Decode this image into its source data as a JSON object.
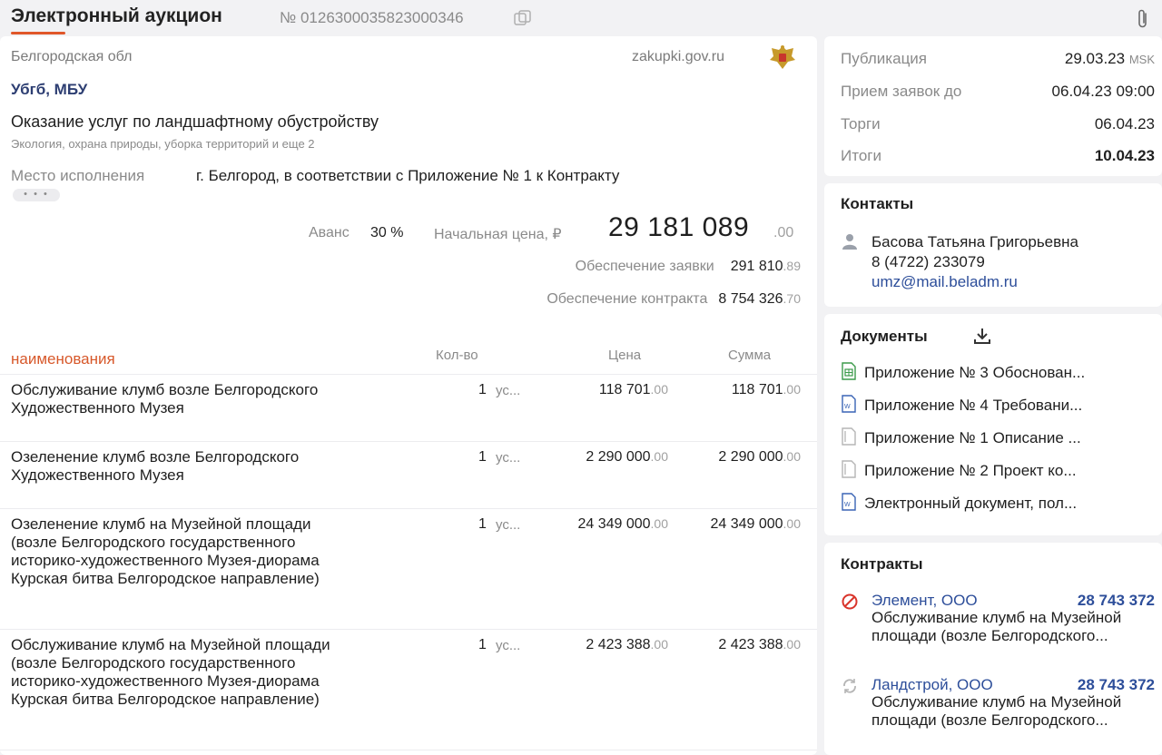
{
  "header": {
    "title": "Электронный аукцион",
    "number": "№ 0126300035823000346"
  },
  "main": {
    "region": "Белгородская обл",
    "site": "zakupki.gov.ru",
    "customer": "Убгб, МБУ",
    "subject": "Оказание услуг по ландшафтному обустройству",
    "categories": "Экология, охрана природы, уборка территорий и еще 2",
    "place_label": "Место исполнения",
    "place_value": "г. Белгород, в соответствии с Приложение № 1 к Контракту",
    "more": "• • •",
    "advance_label": "Аванс",
    "advance_value": "30 %",
    "price_label": "Начальная цена, ₽",
    "price_main": "29 181 089",
    "price_cents": ".00",
    "bid_security_label": "Обеспечение заявки",
    "bid_security_value": "291 810",
    "bid_security_cents": ".89",
    "contract_security_label": "Обеспечение контракта",
    "contract_security_value": "8 754 326",
    "contract_security_cents": ".70"
  },
  "table": {
    "headers": {
      "name": "наименования",
      "qty": "Кол-во",
      "price": "Цена",
      "sum": "Сумма"
    },
    "rows": [
      {
        "name": "Обслуживание клумб возле Белгородского Художественного Музея",
        "qty": "1",
        "unit": "ус...",
        "price": "118 701",
        "price_cents": ".00",
        "sum": "118 701",
        "sum_cents": ".00"
      },
      {
        "name": "Озеленение клумб возле Белгородского Художественного Музея",
        "qty": "1",
        "unit": "ус...",
        "price": "2 290 000",
        "price_cents": ".00",
        "sum": "2 290 000",
        "sum_cents": ".00"
      },
      {
        "name": "Озеленение клумб на Музейной площади (возле Белгородского государственного историко-художественного Музея-диорама Курская битва Белгородское направление)",
        "qty": "1",
        "unit": "ус...",
        "price": "24 349 000",
        "price_cents": ".00",
        "sum": "24 349 000",
        "sum_cents": ".00"
      },
      {
        "name": "Обслуживание клумб на Музейной площади (возле Белгородского государственного историко-художественного Музея-диорама Курская битва Белгородское направление)",
        "qty": "1",
        "unit": "ус...",
        "price": "2 423 388",
        "price_cents": ".00",
        "sum": "2 423 388",
        "sum_cents": ".00"
      }
    ]
  },
  "dates": {
    "publication_label": "Публикация",
    "publication_value": "29.03.23",
    "publication_tz": "MSK",
    "deadline_label": "Прием заявок до",
    "deadline_value": "06.04.23 09:00",
    "auction_label": "Торги",
    "auction_value": "06.04.23",
    "results_label": "Итоги",
    "results_value": "10.04.23"
  },
  "contacts": {
    "title": "Контакты",
    "name": "Басова Татьяна Григорьевна",
    "phone": "8 (4722) 233079",
    "email": "umz@mail.beladm.ru"
  },
  "documents": {
    "title": "Документы",
    "items": [
      {
        "label": "Приложение № 3 Обоснован...",
        "icon": "spreadsheet-doc-icon"
      },
      {
        "label": "Приложение № 4 Требовани...",
        "icon": "word-doc-icon"
      },
      {
        "label": "Приложение № 1 Описание ...",
        "icon": "generic-doc-icon"
      },
      {
        "label": "Приложение № 2  Проект ко...",
        "icon": "generic-doc-icon"
      },
      {
        "label": "Электронный документ, пол...",
        "icon": "word-doc-icon"
      }
    ]
  },
  "contracts": {
    "title": "Контракты",
    "items": [
      {
        "name": "Элемент, ООО",
        "sum": "28 743 372",
        "desc": "Обслуживание клумб на Музейной площади (возле Белгородского...",
        "status_icon": "cancelled-icon"
      },
      {
        "name": "Ландстрой, ООО",
        "sum": "28 743 372",
        "desc": "Обслуживание клумб на Музейной площади (возле Белгородского...",
        "status_icon": "in-progress-icon"
      }
    ]
  },
  "colors": {
    "accent": "#e0572a",
    "link": "#2d4e9a",
    "customer": "#2d3e72",
    "cancel": "#d9342b"
  }
}
